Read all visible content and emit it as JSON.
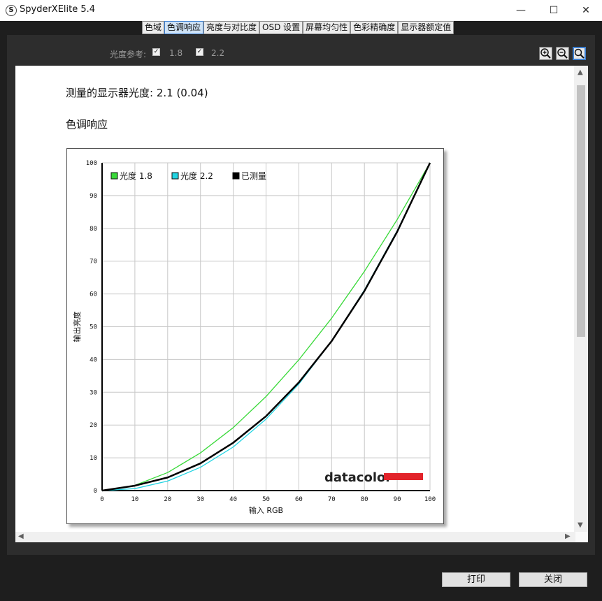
{
  "window": {
    "title": "SpyderXElite 5.4",
    "icon_letter": "S",
    "minimize": "—",
    "maximize": "☐",
    "close": "✕"
  },
  "tabs": [
    {
      "label": "色域"
    },
    {
      "label": "色调响应",
      "active": true
    },
    {
      "label": "亮度与对比度"
    },
    {
      "label": "OSD 设置"
    },
    {
      "label": "屏幕均匀性"
    },
    {
      "label": "色彩精确度"
    },
    {
      "label": "显示器额定值"
    }
  ],
  "toolbar": {
    "reference_label": "光度参考:",
    "ref_18": {
      "label": "1.8",
      "checked": true
    },
    "ref_22": {
      "label": "2.2",
      "checked": true
    },
    "zoom": [
      "zoom-in-icon",
      "zoom-out-icon",
      "zoom-fit-icon"
    ]
  },
  "report": {
    "measured_label": "测量的显示器光度:  2.1 (0.04)",
    "section_title": "色调响应"
  },
  "chart_data": {
    "type": "line",
    "xlabel": "输入 RGB",
    "ylabel": "输出亮度",
    "xlim": [
      0,
      100
    ],
    "ylim": [
      0,
      100
    ],
    "xticks": [
      0,
      10,
      20,
      30,
      40,
      50,
      60,
      70,
      80,
      90,
      100
    ],
    "yticks": [
      0,
      10,
      20,
      30,
      40,
      50,
      60,
      70,
      80,
      90,
      100
    ],
    "grid": true,
    "legend_position": "top-left",
    "series": [
      {
        "name": "光度 1.8",
        "color": "#39d939",
        "x": [
          0,
          10,
          20,
          30,
          40,
          50,
          60,
          70,
          80,
          90,
          100
        ],
        "y": [
          0,
          1.6,
          5.5,
          11.5,
          19.2,
          28.7,
          39.9,
          52.6,
          66.9,
          82.7,
          100
        ]
      },
      {
        "name": "光度 2.2",
        "color": "#22d4e2",
        "x": [
          0,
          10,
          20,
          30,
          40,
          50,
          60,
          70,
          80,
          90,
          100
        ],
        "y": [
          0,
          0.6,
          2.9,
          7.1,
          13.3,
          21.8,
          32.5,
          45.6,
          61.2,
          79.3,
          100
        ]
      },
      {
        "name": "已测量",
        "color": "#000000",
        "x": [
          0,
          10,
          20,
          30,
          40,
          50,
          60,
          70,
          80,
          90,
          100
        ],
        "y": [
          0,
          1.5,
          4.0,
          8.3,
          14.6,
          22.7,
          33.0,
          45.6,
          60.9,
          79.0,
          100
        ]
      }
    ],
    "logo": "datacolor",
    "logo_bar_color": "#e2232a"
  },
  "buttons": {
    "print": "打印",
    "close": "关闭"
  }
}
